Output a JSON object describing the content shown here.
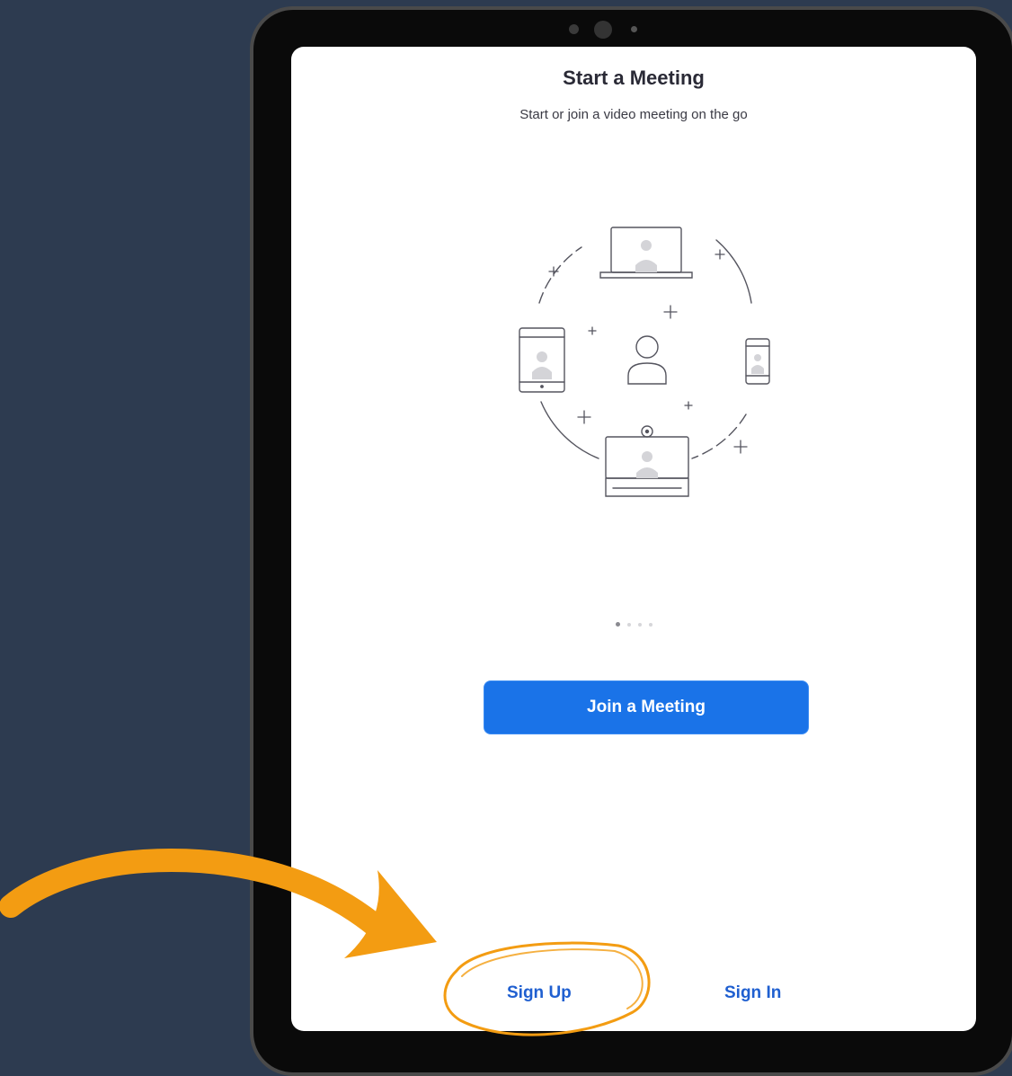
{
  "screen": {
    "title": "Start a Meeting",
    "subtitle": "Start or join a video meeting on the go",
    "pager": {
      "total": 4,
      "active": 1
    },
    "join_label": "Join a Meeting",
    "signup_label": "Sign Up",
    "signin_label": "Sign In",
    "accent_color": "#1a73e8"
  },
  "annotation": {
    "color": "#f39c12",
    "arrow_icon": "curved-arrow-icon",
    "highlight_icon": "hand-drawn-circle-icon"
  }
}
